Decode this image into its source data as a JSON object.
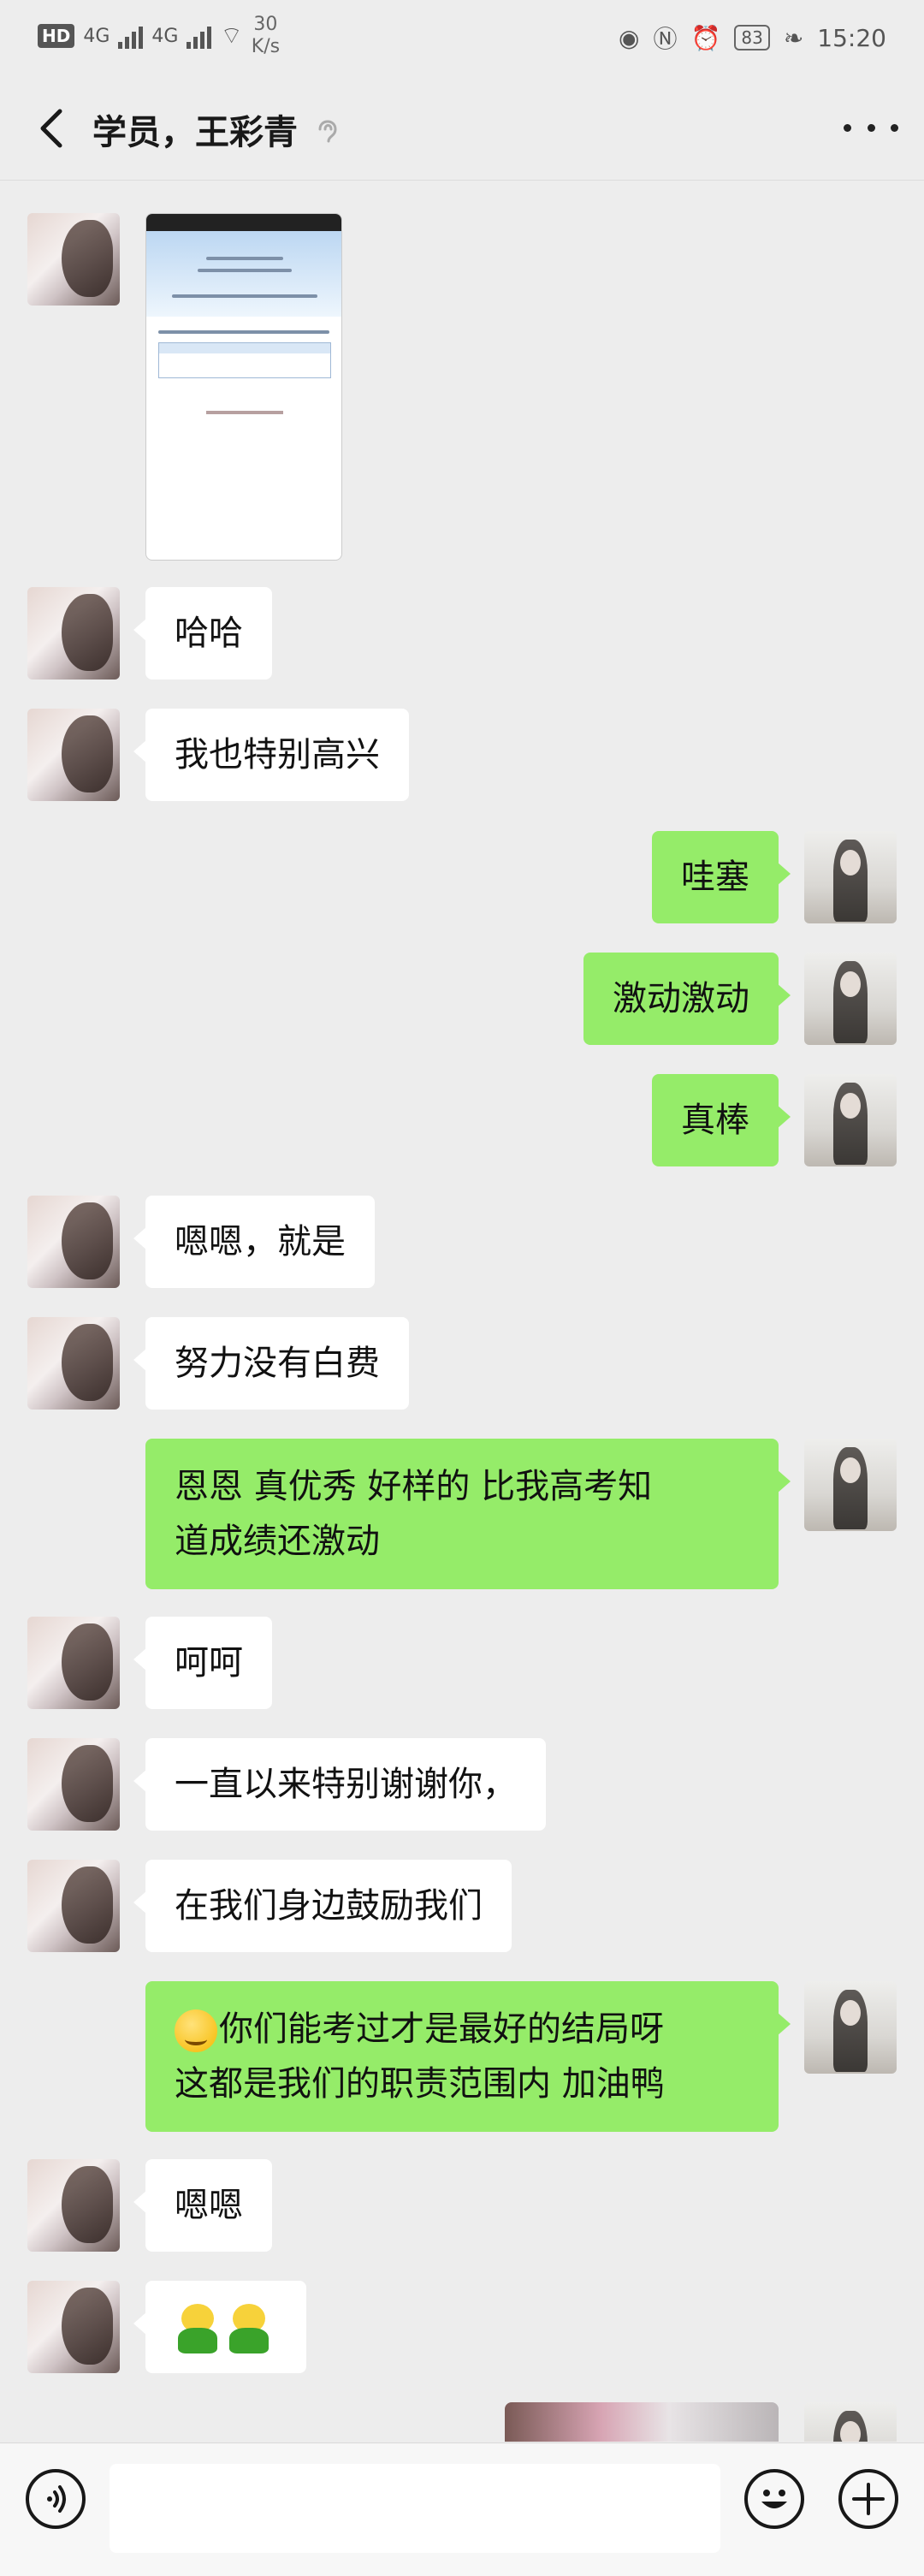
{
  "status_bar": {
    "hd": "HD",
    "net_left_1": "4G",
    "net_left_2": "4G",
    "net_speed_1": "30",
    "net_speed_2": "K/s",
    "battery": "83",
    "time": "15:20"
  },
  "header": {
    "title": "学员，王彩青"
  },
  "messages": [
    {
      "side": "left",
      "type": "image"
    },
    {
      "side": "left",
      "text": "哈哈"
    },
    {
      "side": "left",
      "text": "我也特别高兴"
    },
    {
      "side": "right",
      "text": "哇塞"
    },
    {
      "side": "right",
      "text": "激动激动"
    },
    {
      "side": "right",
      "text": "真棒"
    },
    {
      "side": "left",
      "text": "嗯嗯，就是"
    },
    {
      "side": "left",
      "text": "努力没有白费"
    },
    {
      "side": "right",
      "line1": "恩恩  真优秀  好样的  比我高考知",
      "line2": "道成绩还激动"
    },
    {
      "side": "left",
      "text": "呵呵"
    },
    {
      "side": "left",
      "text": "一直以来特别谢谢你，"
    },
    {
      "side": "left",
      "text": "在我们身边鼓励我们"
    },
    {
      "side": "right",
      "line1": "你们能考过才是最好的结局呀",
      "line2": "这都是我们的职责范围内   加油鸭",
      "emoji": "smile-emoji"
    },
    {
      "side": "left",
      "text": "嗯嗯"
    },
    {
      "side": "left",
      "type": "sticker",
      "emoji": "frog-emoji"
    },
    {
      "side": "right",
      "type": "image"
    }
  ],
  "input": {
    "value": "",
    "placeholder": ""
  }
}
